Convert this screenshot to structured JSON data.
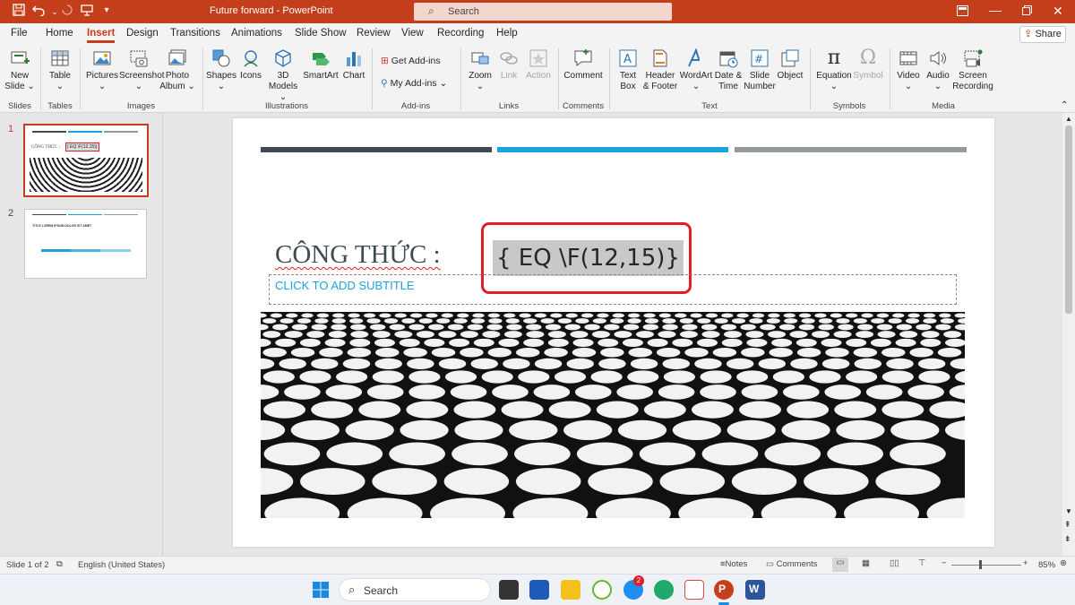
{
  "app": {
    "doc_title": "Future forward",
    "separator": "-",
    "app_name": "PowerPoint"
  },
  "search": {
    "placeholder": "Search"
  },
  "quick_access": {
    "save": "save-icon",
    "undo": "undo-icon",
    "redo": "redo-icon",
    "present": "present-icon",
    "more": "more-icon"
  },
  "tabs": [
    "File",
    "Home",
    "Insert",
    "Design",
    "Transitions",
    "Animations",
    "Slide Show",
    "Review",
    "View",
    "Recording",
    "Help"
  ],
  "active_tab": "Insert",
  "share_label": "Share",
  "ribbon": {
    "slides": {
      "new_slide": "New Slide",
      "label": "Slides"
    },
    "tables": {
      "table": "Table",
      "label": "Tables"
    },
    "images": {
      "pictures": "Pictures",
      "screenshot": "Screenshot",
      "photo_album": "Photo Album",
      "label": "Images"
    },
    "illustrations": {
      "shapes": "Shapes",
      "icons": "Icons",
      "models": "3D Models",
      "smartart": "SmartArt",
      "chart": "Chart",
      "label": "Illustrations"
    },
    "addins": {
      "get": "Get Add-ins",
      "my": "My Add-ins",
      "label": "Add-ins"
    },
    "links": {
      "zoom": "Zoom",
      "link": "Link",
      "action": "Action",
      "label": "Links"
    },
    "comments": {
      "comment": "Comment",
      "label": "Comments"
    },
    "text": {
      "textbox": "Text Box",
      "header_footer": "Header & Footer",
      "wordart": "WordArt",
      "date_time": "Date & Time",
      "slide_number": "Slide Number",
      "object": "Object",
      "label": "Text"
    },
    "symbols": {
      "equation": "Equation",
      "symbol": "Symbol",
      "label": "Symbols"
    },
    "media": {
      "video": "Video",
      "audio": "Audio",
      "screen_recording": "Screen Recording",
      "label": "Media"
    }
  },
  "thumbnails": [
    {
      "num": "1",
      "title": "CÔNG THỨC :",
      "field": "{ EQ \\F(12,15)}"
    },
    {
      "num": "2",
      "title": "TITLE LOREM IPSUM DOLOR SIT AMET"
    }
  ],
  "slide": {
    "title": "CÔNG THỨC :",
    "field_code": "{ EQ \\F(12,15)}",
    "subtitle_placeholder": "CLICK TO ADD SUBTITLE",
    "bar_colors": [
      "#404a52",
      "#1aa3de",
      "#939ba1"
    ]
  },
  "status": {
    "slide_info": "Slide 1 of 2",
    "language": "English (United States)",
    "notes": "Notes",
    "comments": "Comments",
    "zoom": "85%"
  },
  "taskbar": {
    "search": "Search",
    "badge": "2"
  },
  "colors": {
    "accent": "#c43e1c",
    "highlight": "#e01e26"
  }
}
